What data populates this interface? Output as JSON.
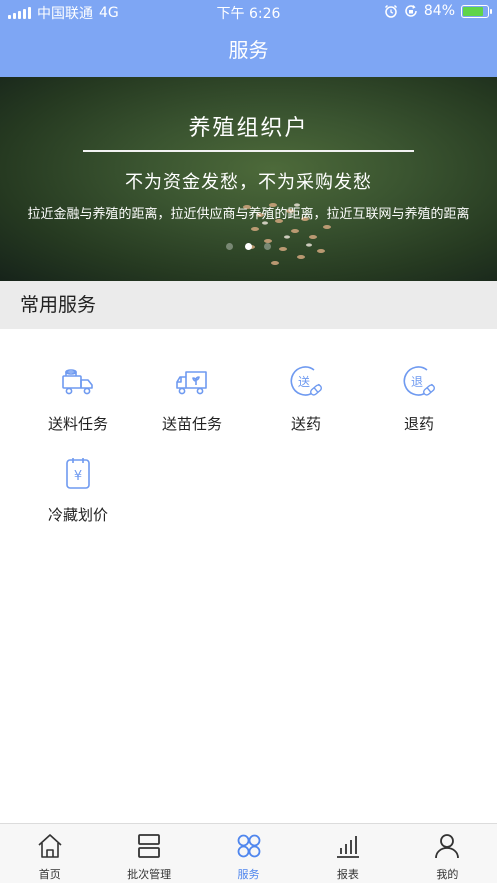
{
  "status_bar": {
    "carrier": "中国联通",
    "network": "4G",
    "time": "下午 6:26",
    "battery": "84%",
    "battery_level": 0.84
  },
  "header": {
    "title": "服务"
  },
  "banner": {
    "title": "养殖组织户",
    "subtitle": "不为资金发愁，不为采购发愁",
    "tagline": "拉近金融与养殖的距离，拉近供应商与养殖的距离，拉近互联网与养殖的距离",
    "slide_count": 3,
    "active_slide": 2
  },
  "section": {
    "title": "常用服务"
  },
  "services": [
    {
      "label": "送料任务",
      "icon": "feed-truck-icon"
    },
    {
      "label": "送苗任务",
      "icon": "seedling-truck-icon"
    },
    {
      "label": "送药",
      "icon": "send-medicine-icon",
      "icon_text": "送"
    },
    {
      "label": "退药",
      "icon": "return-medicine-icon",
      "icon_text": "退"
    },
    {
      "label": "冷藏划价",
      "icon": "price-clipboard-icon",
      "icon_text": "¥"
    }
  ],
  "tabbar": {
    "items": [
      {
        "label": "首页",
        "icon": "home-icon"
      },
      {
        "label": "批次管理",
        "icon": "batch-icon"
      },
      {
        "label": "服务",
        "icon": "services-icon",
        "active": true
      },
      {
        "label": "报表",
        "icon": "chart-icon"
      },
      {
        "label": "我的",
        "icon": "profile-icon"
      }
    ]
  },
  "colors": {
    "brand": "#7ea6f4",
    "icon": "#6f9af0",
    "active_tab": "#4f86ee",
    "section_bg": "#ebebeb"
  }
}
